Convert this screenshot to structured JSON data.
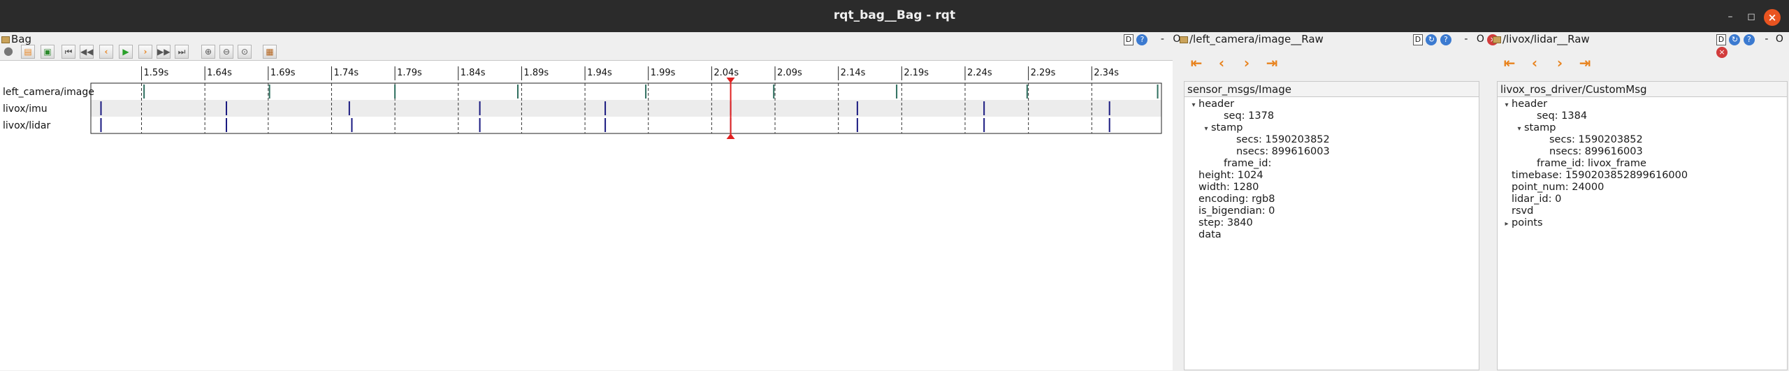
{
  "window": {
    "title": "rqt_bag__Bag - rqt"
  },
  "bag_panel": {
    "title": "Bag",
    "dock": {
      "d": "D",
      "help": "?",
      "minimize": "-",
      "float": "O"
    }
  },
  "toolbar": {
    "buttons": [
      {
        "name": "stop-icon",
        "glyph": "●"
      },
      {
        "name": "open-icon",
        "glyph": "▤"
      },
      {
        "name": "save-icon",
        "glyph": "▣"
      },
      {
        "name": "skip-start-icon",
        "glyph": "⏮"
      },
      {
        "name": "rewind-icon",
        "glyph": "◀◀"
      },
      {
        "name": "step-back-icon",
        "glyph": "‹"
      },
      {
        "name": "play-icon",
        "glyph": "▶"
      },
      {
        "name": "step-forward-icon",
        "glyph": "›"
      },
      {
        "name": "fast-forward-icon",
        "glyph": "▶▶"
      },
      {
        "name": "skip-end-icon",
        "glyph": "⏭"
      },
      {
        "name": "zoom-in-icon",
        "glyph": "⊕"
      },
      {
        "name": "zoom-out-icon",
        "glyph": "⊖"
      },
      {
        "name": "zoom-reset-icon",
        "glyph": "⊙"
      },
      {
        "name": "thumbnails-icon",
        "glyph": "▦"
      }
    ]
  },
  "timeline": {
    "ticks": [
      "1.59s",
      "1.64s",
      "1.69s",
      "1.74s",
      "1.79s",
      "1.84s",
      "1.89s",
      "1.94s",
      "1.99s",
      "2.04s",
      "2.09s",
      "2.14s",
      "2.19s",
      "2.24s",
      "2.29s",
      "2.34s"
    ],
    "start_s": 1.55,
    "end_s": 2.395,
    "playhead_s": 2.055,
    "topics": [
      {
        "name": "left_camera/image",
        "color": "#2f6f5f",
        "messages_s": [
          1.592,
          1.691,
          1.79,
          1.887,
          1.988,
          2.089,
          2.186,
          2.289,
          2.392
        ]
      },
      {
        "name": "livox/imu",
        "color": "#1a1a80",
        "messages_s": [
          1.558,
          1.657,
          1.754,
          1.857,
          1.956,
          2.055,
          2.155,
          2.255,
          2.354
        ]
      },
      {
        "name": "livox/lidar",
        "color": "#1a1a80",
        "messages_s": [
          1.558,
          1.657,
          1.756,
          1.857,
          1.956,
          2.055,
          2.155,
          2.255,
          2.354
        ]
      }
    ],
    "colors": {
      "playhead": "#e02020",
      "background": "#ffffff",
      "row_alt": "#ececec"
    }
  },
  "camera_panel": {
    "title": "/left_camera/image__Raw",
    "dock": {
      "d": "D",
      "minimize": "-",
      "float": "O"
    },
    "message_type": "sensor_msgs/Image",
    "tree": [
      {
        "indent": 0,
        "arrow": "▾",
        "text": "header"
      },
      {
        "indent": 2,
        "arrow": "",
        "text": "seq:  1378"
      },
      {
        "indent": 1,
        "arrow": "▾",
        "text": "stamp"
      },
      {
        "indent": 3,
        "arrow": "",
        "text": "secs:  1590203852"
      },
      {
        "indent": 3,
        "arrow": "",
        "text": "nsecs:  899616003"
      },
      {
        "indent": 2,
        "arrow": "",
        "text": "frame_id:"
      },
      {
        "indent": 0,
        "arrow": "",
        "text": "height:  1024"
      },
      {
        "indent": 0,
        "arrow": "",
        "text": "width:  1280"
      },
      {
        "indent": 0,
        "arrow": "",
        "text": "encoding:  rgb8"
      },
      {
        "indent": 0,
        "arrow": "",
        "text": "is_bigendian:  0"
      },
      {
        "indent": 0,
        "arrow": "",
        "text": "step:  3840"
      },
      {
        "indent": 0,
        "arrow": "",
        "text": "data"
      }
    ]
  },
  "lidar_panel": {
    "title": "/livox/lidar__Raw",
    "dock": {
      "d": "D",
      "minimize": "-",
      "float": "O"
    },
    "message_type": "livox_ros_driver/CustomMsg",
    "tree": [
      {
        "indent": 0,
        "arrow": "▾",
        "text": "header"
      },
      {
        "indent": 2,
        "arrow": "",
        "text": "seq:  1384"
      },
      {
        "indent": 1,
        "arrow": "▾",
        "text": "stamp"
      },
      {
        "indent": 3,
        "arrow": "",
        "text": "secs:  1590203852"
      },
      {
        "indent": 3,
        "arrow": "",
        "text": "nsecs:  899616003"
      },
      {
        "indent": 2,
        "arrow": "",
        "text": "frame_id: livox_frame"
      },
      {
        "indent": 0,
        "arrow": "",
        "text": "timebase:  1590203852899616000"
      },
      {
        "indent": 0,
        "arrow": "",
        "text": "point_num:  24000"
      },
      {
        "indent": 0,
        "arrow": "",
        "text": "lidar_id:  0"
      },
      {
        "indent": 0,
        "arrow": "",
        "text": "rsvd"
      },
      {
        "indent": 0,
        "arrow": "▸",
        "text": "points"
      }
    ]
  }
}
